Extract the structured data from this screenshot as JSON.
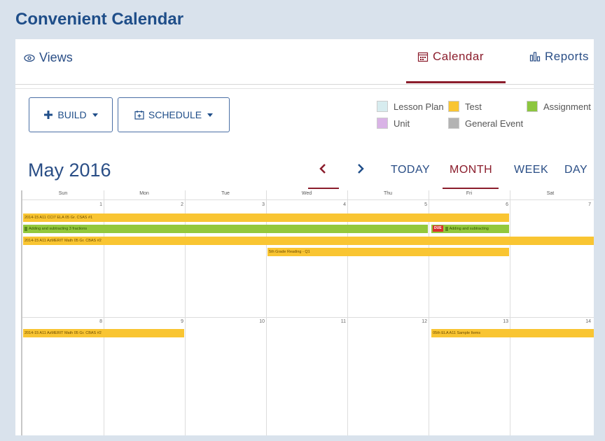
{
  "app": {
    "title": "Convenient Calendar"
  },
  "header": {
    "views_label": "Views",
    "calendar_tab": "Calendar",
    "reports_tab": "Reports"
  },
  "toolbar": {
    "build_label": "BUILD",
    "schedule_label": "SCHEDULE"
  },
  "legend": {
    "items": [
      {
        "label": "Lesson Plan",
        "color": "#d7ecef"
      },
      {
        "label": "Test",
        "color": "#f9c532"
      },
      {
        "label": "Assignment",
        "color": "#8cc63f"
      },
      {
        "label": "Unit",
        "color": "#d9b3e6"
      },
      {
        "label": "General Event",
        "color": "#b3b3b3"
      }
    ]
  },
  "calendar": {
    "month_title": "May 2016",
    "prev_icon": "chevron-left-icon",
    "next_icon": "chevron-right-icon",
    "today_label": "TODAY",
    "month_label": "MONTH",
    "week_label": "WEEK",
    "day_label": "DAY",
    "days_of_week": [
      "Sun",
      "Mon",
      "Tue",
      "Wed",
      "Thu",
      "Fri",
      "Sat"
    ],
    "week1_days": [
      "1",
      "2",
      "3",
      "4",
      "5",
      "6",
      "7"
    ],
    "week2_days": [
      "8",
      "9",
      "10",
      "11",
      "12",
      "13",
      "14"
    ],
    "events": {
      "e1": "2014-15 A11 CCI7 ELA 05 Gr. CSAS #1",
      "e2": "Adding and subtracting 3 fractions",
      "e2b_due": "DUE",
      "e2b": "Adding and subtracting",
      "e3": "2014-15 A11 AzMERIT Math 05 Gr. CBAS #2",
      "e4": "5th Grade Reading - Q1",
      "e5": "2014-15 A11 AzMERIT Math 05 Gr. CBAS #2",
      "e6": "05th ELA A11 Sample Items"
    }
  }
}
